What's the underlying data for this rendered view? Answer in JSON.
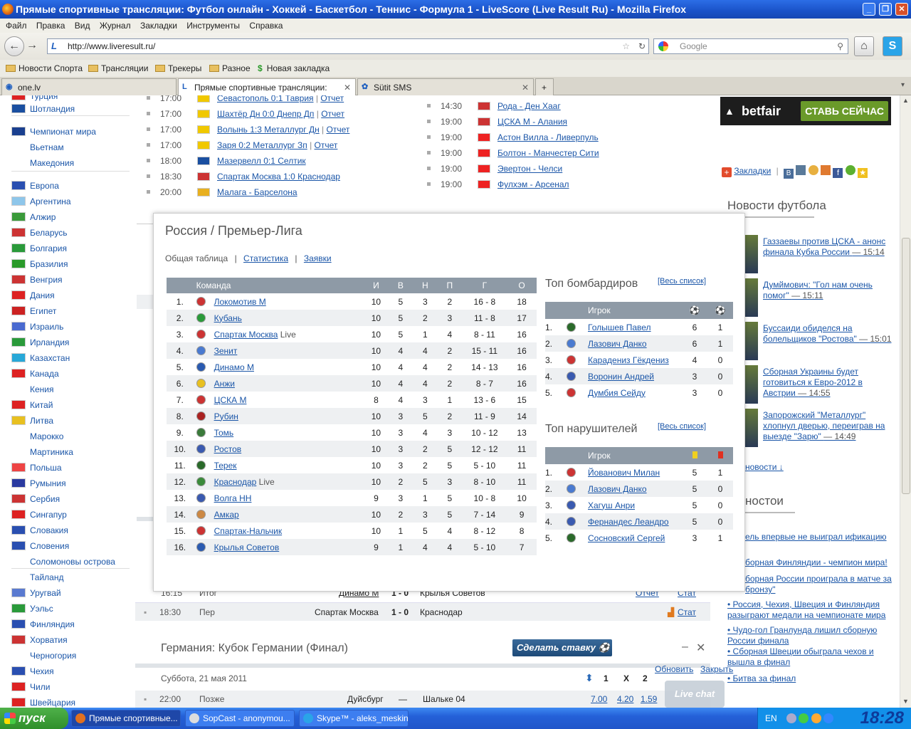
{
  "window": {
    "title": "Прямые спортивные трансляции: Футбол онлайн - Хоккей - Баскетбол - Теннис - Формула 1 - LiveScore (Live Result Ru) - Mozilla Firefox"
  },
  "menu": [
    "Файл",
    "Правка",
    "Вид",
    "Журнал",
    "Закладки",
    "Инструменты",
    "Справка"
  ],
  "nav": {
    "url": "http://www.liveresult.ru/",
    "search_placeholder": "Google"
  },
  "bookmarks": [
    "Новости Спорта",
    "Трансляции",
    "Трекеры",
    "Разное",
    "Новая закладка"
  ],
  "tabs": [
    "one.lv",
    "Прямые спортивные трансляции: Футб...",
    "Sütit SMS"
  ],
  "countries": [
    {
      "name": "Турция",
      "color": "#d22"
    },
    {
      "name": "Шотландия",
      "color": "#1a4fa0"
    },
    {
      "name": "Чемпионат мира",
      "color": "#1a3f8f"
    },
    {
      "name": "Вьетнам",
      "color": ""
    },
    {
      "name": "Македония",
      "color": ""
    },
    {
      "name": "Европа",
      "color": "#2a4fb0"
    },
    {
      "name": "Аргентина",
      "color": "#8ec6ea"
    },
    {
      "name": "Алжир",
      "color": "#3a9a3a"
    },
    {
      "name": "Беларусь",
      "color": "#c33"
    },
    {
      "name": "Болгария",
      "color": "#2a9a3a"
    },
    {
      "name": "Бразилия",
      "color": "#2a9a2a"
    },
    {
      "name": "Венгрия",
      "color": "#c33"
    },
    {
      "name": "Дания",
      "color": "#d22"
    },
    {
      "name": "Египет",
      "color": "#c22"
    },
    {
      "name": "Израиль",
      "color": "#4a6ad0"
    },
    {
      "name": "Ирландия",
      "color": "#2a9a3a"
    },
    {
      "name": "Казахстан",
      "color": "#28a8d8"
    },
    {
      "name": "Канада",
      "color": "#d22"
    },
    {
      "name": "Кения",
      "color": ""
    },
    {
      "name": "Китай",
      "color": "#d22"
    },
    {
      "name": "Литва",
      "color": "#e8c020"
    },
    {
      "name": "Марокко",
      "color": ""
    },
    {
      "name": "Мартиника",
      "color": ""
    },
    {
      "name": "Польша",
      "color": "#e44"
    },
    {
      "name": "Румыния",
      "color": "#2a3aa0"
    },
    {
      "name": "Сербия",
      "color": "#c33"
    },
    {
      "name": "Сингапур",
      "color": "#d22"
    },
    {
      "name": "Словакия",
      "color": "#2a4fb0"
    },
    {
      "name": "Словения",
      "color": "#2a4fb0"
    },
    {
      "name": "Соломоновы острова",
      "color": ""
    },
    {
      "name": "Тайланд",
      "color": ""
    },
    {
      "name": "Уругвай",
      "color": "#5a7ad0"
    },
    {
      "name": "Уэльс",
      "color": "#2a9a3a"
    },
    {
      "name": "Финляндия",
      "color": "#2a4fb0"
    },
    {
      "name": "Хорватия",
      "color": "#c33"
    },
    {
      "name": "Черногория",
      "color": ""
    },
    {
      "name": "Чехия",
      "color": "#2a4fb0"
    },
    {
      "name": "Чили",
      "color": "#d22"
    },
    {
      "name": "Швейцария",
      "color": "#d22"
    }
  ],
  "matches_left": [
    {
      "time": "17:00",
      "text": "Севастополь 0:1 Таврия",
      "report": "Отчет",
      "flag": "#f0c800"
    },
    {
      "time": "17:00",
      "text": "Шахтёр Дн 0:0 Днепр Дп",
      "report": "Отчет",
      "flag": "#f0c800"
    },
    {
      "time": "17:00",
      "text": "Волынь 1:3 Металлург Дн",
      "report": "Отчет",
      "flag": "#f0c800"
    },
    {
      "time": "17:00",
      "text": "Заря 0:2 Металлург Зп",
      "report": "Отчет",
      "flag": "#f0c800"
    },
    {
      "time": "18:00",
      "text": "Мазервелл 0:1 Селтик",
      "report": "",
      "flag": "#1a4fa0"
    },
    {
      "time": "18:30",
      "text": "Спартак Москва 1:0 Краснодар",
      "report": "",
      "flag": "#c33"
    },
    {
      "time": "20:00",
      "text": "Малага - Барселона",
      "report": "",
      "flag": "#e8b020"
    }
  ],
  "matches_right": [
    {
      "time": "14:30",
      "text": "Рода - Ден Хааг",
      "flag": "#c33"
    },
    {
      "time": "19:00",
      "text": "ЦСКА М - Алания",
      "flag": "#c33"
    },
    {
      "time": "19:00",
      "text": "Астон Вилла - Ливерпуль",
      "flag": "#e22"
    },
    {
      "time": "19:00",
      "text": "Болтон - Манчестер Сити",
      "flag": "#e22"
    },
    {
      "time": "19:00",
      "text": "Эвертон - Челси",
      "flag": "#e22"
    },
    {
      "time": "19:00",
      "text": "Фулхэм - Арсенал",
      "flag": "#e22"
    }
  ],
  "ad": {
    "brand": "betfair",
    "cta": "СТАВЬ СЕЙЧАС"
  },
  "share": {
    "label": "Закладки"
  },
  "news": {
    "title": "Новости футбола",
    "items": [
      {
        "text": "Газзаевы против ЦСКА - анонс финала Кубка России",
        "time": "— 15:14"
      },
      {
        "text": "Думймович: \"Гол нам очень помог\"",
        "time": "— 15:11"
      },
      {
        "text": "Буссаиди обиделся на болельщиков \"Ростова\"",
        "time": "— 15:01"
      },
      {
        "text": "Сборная Украины будет готовиться к Евро-2012 в Австрии",
        "time": "— 14:55"
      },
      {
        "text": "Запорожский \"Металлург\" хлопнул дверью, переиграв на выезде \"Зарю\"",
        "time": "— 14:49"
      }
    ],
    "more": "новости ↓",
    "title2": "ностои",
    "items2": [
      "ель впервые не выиграл ификацию",
      "борная Финляндии - чемпион мира!",
      "борная России проиграла в матче за бронзу\"",
      "Россия, Чехия, Швеция и Финляндия разыгрaют медали на чемпионате мира",
      "Чудо-гол Гранлунда лишил сборную России финала",
      "Сборная Швеции обыграла чехов и вышла в финал",
      "Битва за финал"
    ]
  },
  "popup": {
    "title": "Россия / Премьер-Лига",
    "tab_active": "Общая таблица",
    "tab_stats": "Статистика",
    "tab_apps": "Заявки",
    "headers": [
      "Команда",
      "И",
      "В",
      "Н",
      "П",
      "Г",
      "О"
    ],
    "rows": [
      [
        "1.",
        "Локомотив М",
        "",
        "10",
        "5",
        "3",
        "2",
        "16 - 8",
        "18"
      ],
      [
        "2.",
        "Кубань",
        "",
        "10",
        "5",
        "2",
        "3",
        "11 - 8",
        "17"
      ],
      [
        "3.",
        "Спартак Москва",
        "Live",
        "10",
        "5",
        "1",
        "4",
        "8 - 11",
        "16"
      ],
      [
        "4.",
        "Зенит",
        "",
        "10",
        "4",
        "4",
        "2",
        "15 - 11",
        "16"
      ],
      [
        "5.",
        "Динамо М",
        "",
        "10",
        "4",
        "4",
        "2",
        "14 - 13",
        "16"
      ],
      [
        "6.",
        "Анжи",
        "",
        "10",
        "4",
        "4",
        "2",
        "8 - 7",
        "16"
      ],
      [
        "7.",
        "ЦСКА М",
        "",
        "8",
        "4",
        "3",
        "1",
        "13 - 6",
        "15"
      ],
      [
        "8.",
        "Рубин",
        "",
        "10",
        "3",
        "5",
        "2",
        "11 - 9",
        "14"
      ],
      [
        "9.",
        "Томь",
        "",
        "10",
        "3",
        "4",
        "3",
        "10 - 12",
        "13"
      ],
      [
        "10.",
        "Ростов",
        "",
        "10",
        "3",
        "2",
        "5",
        "12 - 12",
        "11"
      ],
      [
        "11.",
        "Терек",
        "",
        "10",
        "3",
        "2",
        "5",
        "5 - 10",
        "11"
      ],
      [
        "12.",
        "Краснодар",
        "Live",
        "10",
        "2",
        "5",
        "3",
        "8 - 10",
        "11"
      ],
      [
        "13.",
        "Волга НН",
        "",
        "9",
        "3",
        "1",
        "5",
        "10 - 8",
        "10"
      ],
      [
        "14.",
        "Амкар",
        "",
        "10",
        "2",
        "3",
        "5",
        "7 - 14",
        "9"
      ],
      [
        "15.",
        "Спартак-Нальчик",
        "",
        "10",
        "1",
        "5",
        "4",
        "8 - 12",
        "8"
      ],
      [
        "16.",
        "Крылья Советов",
        "",
        "9",
        "1",
        "4",
        "4",
        "5 - 10",
        "7"
      ]
    ],
    "scorers_title": "Топ бомбардиров",
    "full_list": "[Весь список]",
    "player_header": "Игрок",
    "scorers": [
      [
        "1.",
        "Голышев Павел",
        "6",
        "1"
      ],
      [
        "2.",
        "Лазович Данко",
        "6",
        "1"
      ],
      [
        "3.",
        "Карадениз Гёкдениз",
        "4",
        "0"
      ],
      [
        "4.",
        "Воронин Андрей",
        "3",
        "0"
      ],
      [
        "5.",
        "Думбия Сейду",
        "3",
        "0"
      ]
    ],
    "offenders_title": "Топ нарушителей",
    "offenders": [
      [
        "1.",
        "Йованович Милан",
        "5",
        "1"
      ],
      [
        "2.",
        "Лазович Данко",
        "5",
        "0"
      ],
      [
        "3.",
        "Хагуш Анри",
        "5",
        "0"
      ],
      [
        "4.",
        "Фернандес Леандро",
        "5",
        "0"
      ],
      [
        "5.",
        "Сосновский Сергей",
        "3",
        "1"
      ]
    ],
    "refresh": "Обновить",
    "close": "Закрыть"
  },
  "bottom": {
    "row1": {
      "time": "16:15",
      "status": "Итог",
      "home": "Динамо М",
      "score": "1 - 0",
      "away": "Крылья Советов",
      "report": "Отчет",
      "stat": "Стат"
    },
    "row2": {
      "time": "18:30",
      "status": "Пер",
      "home": "Спартак Москва",
      "score": "1 - 0",
      "away": "Краснодар",
      "stat": "Стат"
    },
    "league": "Германия: Кубок Германии (Финал)",
    "bet_btn": "Сделать ставку",
    "date": "Суббота, 21 мая 2011",
    "cols": [
      "1",
      "X",
      "2"
    ],
    "row3": {
      "time": "22:00",
      "status": "Позже",
      "home": "Дуйсбург",
      "score": "—",
      "away": "Шальке 04",
      "o1": "7.00",
      "ox": "4.20",
      "o2": "1.59",
      "stat": "Стат"
    },
    "livechat": "Live chat"
  },
  "taskbar": {
    "start": "пуск",
    "tasks": [
      "Прямые спортивные...",
      "SopCast - anonymou...",
      "Skype™ - aleks_meskini"
    ],
    "lang": "EN",
    "clock": "18:28"
  }
}
